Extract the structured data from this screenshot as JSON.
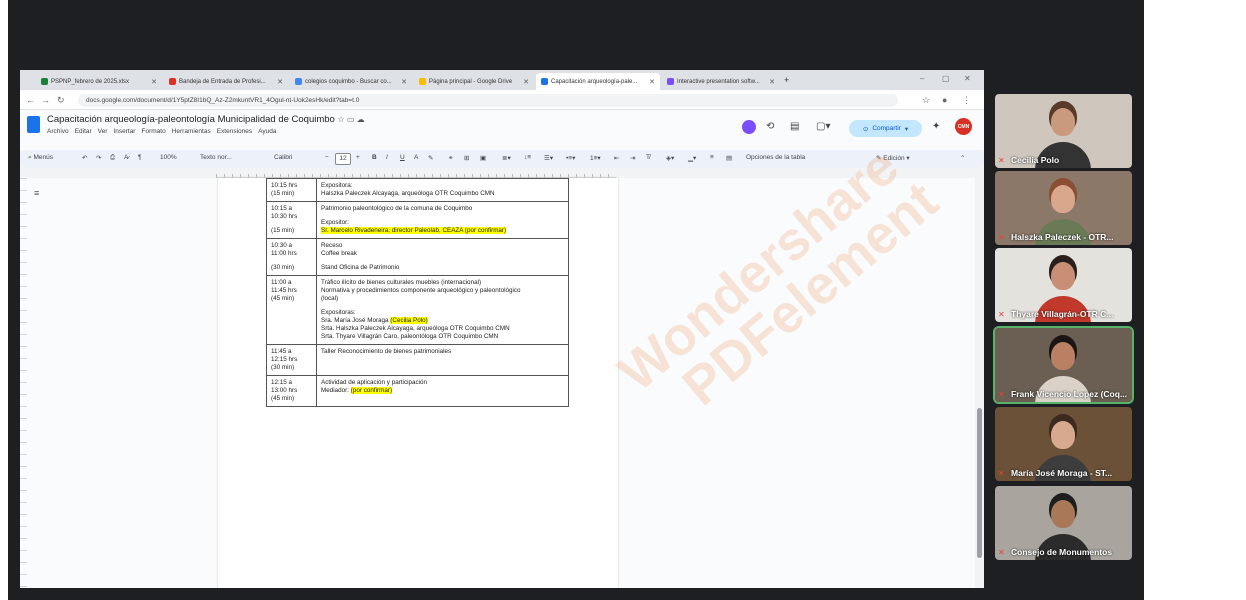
{
  "tabs": [
    {
      "label": "PSPNP_febrero de 2025.xlsx",
      "color": "#188038"
    },
    {
      "label": "Bandeja de Entrada de Profesi...",
      "color": "#d93025"
    },
    {
      "label": "colegios coquimbo - Buscar co...",
      "color": "#4285f4"
    },
    {
      "label": "Página principal - Google Drive",
      "color": "#fbbc04"
    },
    {
      "label": "Capacitación arqueología-pale...",
      "color": "#1a73e8"
    },
    {
      "label": "Interactive presentation softw...",
      "color": "#7c4dff"
    }
  ],
  "address_bar": {
    "url": "docs.google.com/document/d/1Y5ptZ8I1bQ_Az-Z2mkuntVR1_4Ogul-nt-Uok2esHk/edit?tab=t.0"
  },
  "docs": {
    "title": "Capacitación arqueología-paleontología Municipalidad de Coquimbo",
    "menu": [
      "Archivo",
      "Editar",
      "Ver",
      "Insertar",
      "Formato",
      "Herramientas",
      "Extensiones",
      "Ayuda"
    ],
    "share_label": "Compartir",
    "cmn_label": "CMN"
  },
  "toolbar": {
    "menus": "Menús",
    "zoom": "100%",
    "style": "Texto nor...",
    "font": "Calibri",
    "font_size": "12",
    "table_options": "Opciones de la tabla",
    "edit_mode": "Edición"
  },
  "agenda": [
    {
      "time": [
        "10:15 hrs",
        "(15 min)"
      ],
      "lines": [
        [
          "",
          "Expositora:"
        ],
        [
          "",
          "Halszka Paleczek Alcayaga, arqueóloga OTR Coquimbo CMN"
        ]
      ]
    },
    {
      "time": [
        "10:15 a",
        "10:30 hrs",
        "",
        "(15 min)"
      ],
      "lines": [
        [
          "",
          "Patrimonio paleontológico de la comuna de Coquimbo"
        ],
        [
          "",
          ""
        ],
        [
          "",
          "Expositor:"
        ],
        [
          "hl",
          "Sr. Marcelo Rivadeneira, director Paleolab, CEAZA (por confirmar)"
        ]
      ]
    },
    {
      "time": [
        "10:30 a",
        "11:00 hrs",
        "",
        "(30 min)"
      ],
      "lines": [
        [
          "",
          "Receso"
        ],
        [
          "",
          "Coffee break"
        ],
        [
          "",
          ""
        ],
        [
          "",
          "Stand Oficina de Patrimonio"
        ]
      ]
    },
    {
      "time": [
        "11:00 a",
        "11:45 hrs",
        "(45 min)"
      ],
      "lines": [
        [
          "",
          "Tráfico ilícito de bienes culturales muebles (internacional)"
        ],
        [
          "",
          "Normativa y procedimientos componente arqueológico y paleontológico"
        ],
        [
          "",
          "(local)"
        ],
        [
          "",
          ""
        ],
        [
          "",
          "Expositoras:"
        ],
        [
          "mix",
          "Sra. María José Moraga ",
          "(Cecilia Polo)"
        ],
        [
          "",
          "Srta. Halszka Paleczek Alcayaga, arqueóloga OTR Coquimbo CMN"
        ],
        [
          "",
          "Srta. Thyare Villagrán Caro, paleontóloga OTR Coquimbo CMN"
        ]
      ]
    },
    {
      "time": [
        "11:45 a",
        "12:15 hrs",
        "(30 min)"
      ],
      "lines": [
        [
          "",
          "Taller Reconocimiento de bienes patrimoniales"
        ]
      ]
    },
    {
      "time": [
        "12:15 a",
        "13:00 hrs",
        "(45 min)"
      ],
      "lines": [
        [
          "",
          "Actividad de aplicación y participación"
        ],
        [
          "mix",
          "Mediador: ",
          "(por confirmar)"
        ]
      ]
    }
  ],
  "participants": [
    {
      "name": "Cecilia Polo",
      "bg": "#cfc7bd",
      "skin": "#c99a7e",
      "hair": "#5a3a28",
      "shirt": "#333333"
    },
    {
      "name": "Halszka Paleczek - OTR...",
      "bg": "#8c7868",
      "skin": "#d9a88c",
      "hair": "#8a4f32",
      "shirt": "#6b7a56"
    },
    {
      "name": "Thyare Villagrán-OTR C...",
      "bg": "#e4e2dc",
      "skin": "#c98f76",
      "hair": "#2a1f1a",
      "shirt": "#c0392b"
    },
    {
      "name": "Frank Vicencio Lopez (Coq...",
      "bg": "#6a5f52",
      "skin": "#b98064",
      "hair": "#1b1614",
      "shirt": "#d8d2c8"
    },
    {
      "name": "María José Moraga - ST...",
      "bg": "#6b5138",
      "skin": "#d7a98f",
      "hair": "#3b2a1e",
      "shirt": "#3d3d3d"
    },
    {
      "name": "Consejo de Monumentos",
      "bg": "#a9a49e",
      "skin": "#a87858",
      "hair": "#1e1e1e",
      "shirt": "#2b2b2b"
    }
  ],
  "watermark": {
    "line1": "Wondershare",
    "line2": "PDFelement"
  }
}
